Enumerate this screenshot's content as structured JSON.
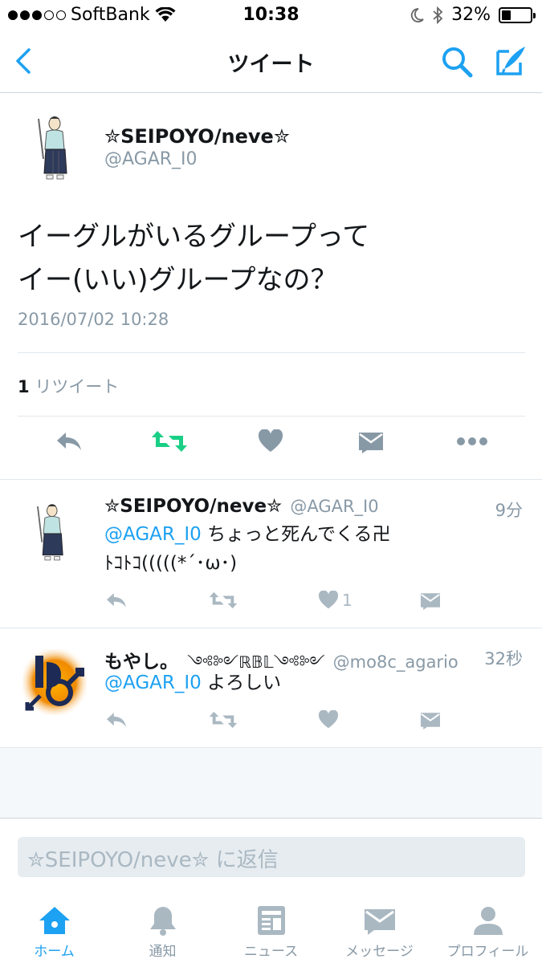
{
  "status_bar": {
    "carrier": "SoftBank",
    "time": "10:38",
    "battery": "32%",
    "battery_level": 0.32
  },
  "nav": {
    "title": "ツイート",
    "back_icon": "chevron-left-icon",
    "search_icon": "search-icon",
    "compose_icon": "compose-icon"
  },
  "main_tweet": {
    "name": "✮SEIPOYO/neve✮",
    "handle": "@AGAR_I0",
    "text_line1": "イーグルがいるグループって",
    "text_line2": "イー(いい)グループなの？",
    "timestamp": "2016/07/02 10:28",
    "retweet_count": "1",
    "retweet_label": "リツイート"
  },
  "replies": [
    {
      "name": "✮SEIPOYO/neve✮",
      "handle": "@AGAR_I0",
      "time": "9分",
      "mention": "@AGAR_I0",
      "text": " ちょっと死んでくる卍",
      "text_line2": "ﾄｺﾄｺ(((((*´･ω･)",
      "like_count": "1"
    },
    {
      "name": "もやし。",
      "name_deco": "༺༻ℝ𝔹𝕃༺༻",
      "handle": "@mo8c_agario",
      "time": "32秒",
      "mention": "@AGAR_I0",
      "text": " よろしい"
    }
  ],
  "reply_bar": {
    "placeholder": "✮SEIPOYO/neve✮ に返信"
  },
  "tabs": [
    {
      "label": "ホーム",
      "icon": "home-icon",
      "active": true
    },
    {
      "label": "通知",
      "icon": "bell-icon",
      "active": false
    },
    {
      "label": "ニュース",
      "icon": "news-icon",
      "active": false
    },
    {
      "label": "メッセージ",
      "icon": "envelope-icon",
      "active": false
    },
    {
      "label": "プロフィール",
      "icon": "person-icon",
      "active": false
    }
  ],
  "colors": {
    "accent": "#1da1f2",
    "retweet_green": "#19cf86",
    "icon_gray": "#aab8c2",
    "text_gray": "#8899a6"
  }
}
